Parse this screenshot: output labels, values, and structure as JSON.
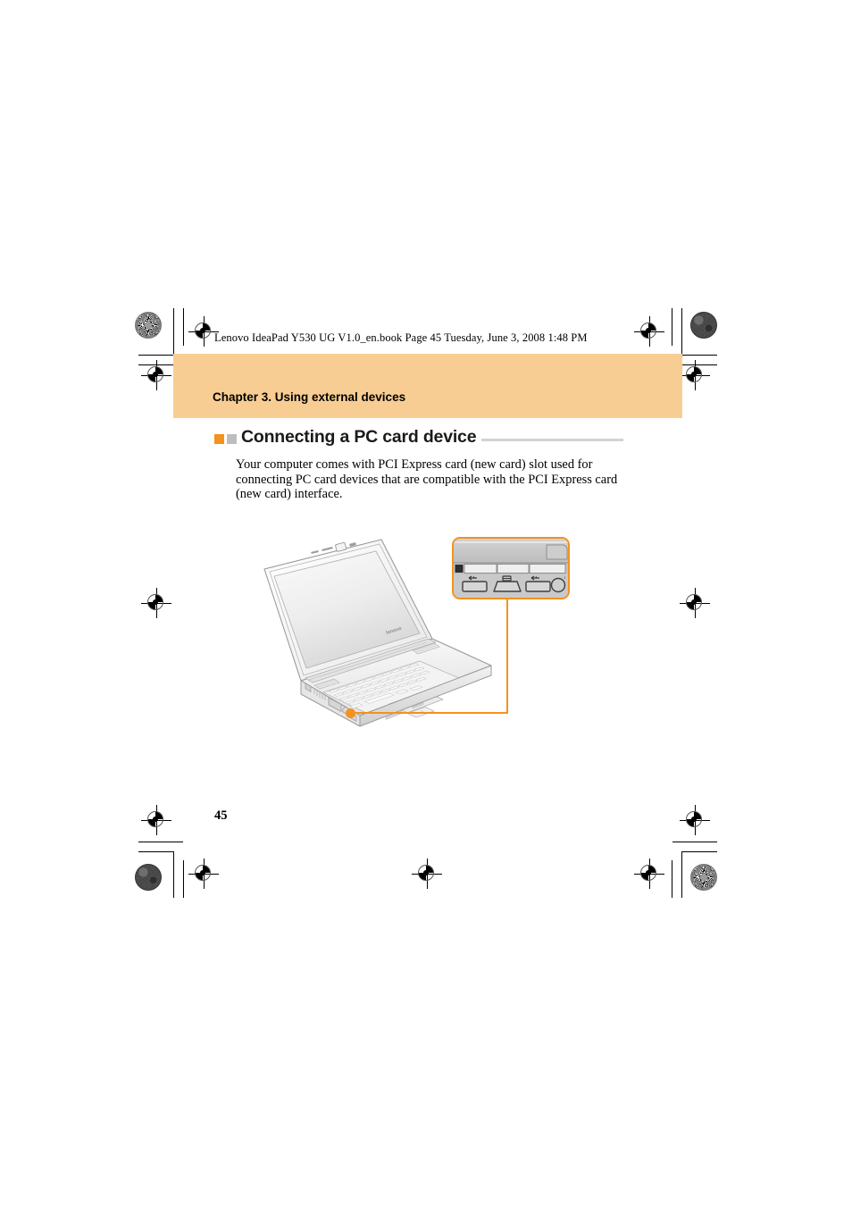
{
  "document": {
    "file_header": "Lenovo IdeaPad Y530 UG V1.0_en.book  Page 45  Tuesday, June 3, 2008  1:48 PM",
    "chapter_banner": "Chapter 3. Using external devices",
    "section_title": "Connecting a PC card device",
    "body_paragraph_line1": "Your computer comes with PCI Express card (new card) slot used for",
    "body_paragraph_line2": "connecting PC card devices that are compatible with the PCI Express card",
    "body_paragraph_line3": "(new card) interface.",
    "page_number": "45"
  },
  "colors": {
    "banner_bg": "#f8cd93",
    "accent_orange": "#f5911e",
    "bullet_gray": "#bdbdbd",
    "rule_gray": "#d2d2d2",
    "device_gray": "#c9c9c9",
    "line_gray": "#8a8a8a"
  },
  "illustration": {
    "name": "laptop-with-port-callout",
    "laptop_brand_text": "lenovo",
    "callout": {
      "name": "left-side-ports-zoom",
      "ports": [
        {
          "name": "express-card-slot"
        },
        {
          "name": "usb-port-left"
        },
        {
          "name": "hdmi-port"
        },
        {
          "name": "usb-port-right"
        },
        {
          "name": "audio-jack"
        }
      ]
    },
    "leader": {
      "name": "callout-leader-line"
    },
    "hotspot": {
      "name": "express-card-slot-hotspot"
    }
  },
  "print_marks": {
    "registration_marks": [
      {
        "name": "reg-mark-top-left"
      },
      {
        "name": "reg-mark-top-left-inner"
      },
      {
        "name": "reg-mark-top-right-inner"
      },
      {
        "name": "reg-mark-top-right"
      },
      {
        "name": "reg-mark-mid-left"
      },
      {
        "name": "reg-mark-mid-right"
      },
      {
        "name": "reg-mark-bottom-left"
      },
      {
        "name": "reg-mark-bottom-left-inner"
      },
      {
        "name": "reg-mark-bottom-center"
      },
      {
        "name": "reg-mark-bottom-right-inner"
      },
      {
        "name": "reg-mark-bottom-right"
      }
    ],
    "density_dots": [
      {
        "name": "density-dot-top-left",
        "style": "halftone"
      },
      {
        "name": "density-dot-top-right",
        "style": "solid"
      },
      {
        "name": "density-dot-bottom-left",
        "style": "solid"
      },
      {
        "name": "density-dot-bottom-right",
        "style": "halftone"
      }
    ]
  }
}
